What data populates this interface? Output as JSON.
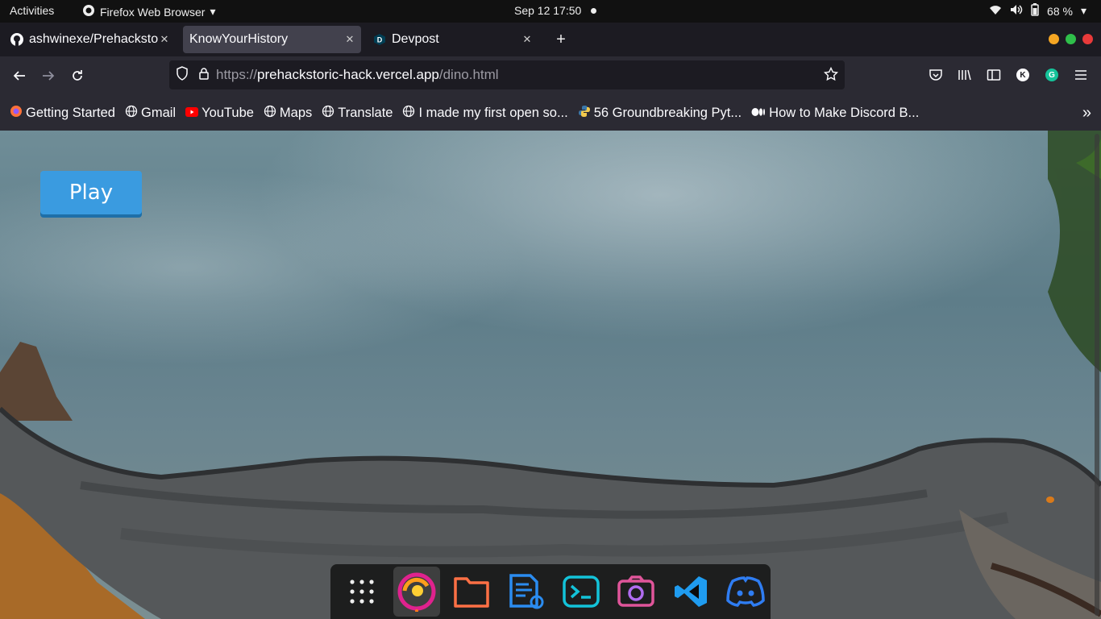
{
  "topbar": {
    "activities": "Activities",
    "app_name": "Firefox Web Browser",
    "clock": "Sep 12  17:50",
    "battery": "68 %"
  },
  "tabs": [
    {
      "title": "ashwinexe/Prehackstoric-hack",
      "active": false
    },
    {
      "title": "KnowYourHistory",
      "active": true
    },
    {
      "title": "Devpost",
      "active": false
    }
  ],
  "navbar": {
    "url_scheme": "https://",
    "url_host": "prehackstoric-hack.vercel.app",
    "url_path": "/dino.html",
    "profile_letter": "K",
    "grammarly_letter": "G"
  },
  "bookmarks": [
    {
      "label": "Getting Started",
      "icon": "firefox-icon"
    },
    {
      "label": "Gmail",
      "icon": "globe-icon"
    },
    {
      "label": "YouTube",
      "icon": "youtube-icon"
    },
    {
      "label": "Maps",
      "icon": "globe-icon"
    },
    {
      "label": "Translate",
      "icon": "globe-icon"
    },
    {
      "label": "I made my first open so...",
      "icon": "globe-icon"
    },
    {
      "label": "56 Groundbreaking Pyt...",
      "icon": "python-icon"
    },
    {
      "label": "How to Make Discord B...",
      "icon": "medium-icon"
    }
  ],
  "page": {
    "play_label": "Play"
  },
  "dock": [
    "apps-grid-icon",
    "firefox-icon",
    "files-icon",
    "text-editor-icon",
    "terminal-icon",
    "screenshot-icon",
    "vscode-icon",
    "discord-icon"
  ]
}
